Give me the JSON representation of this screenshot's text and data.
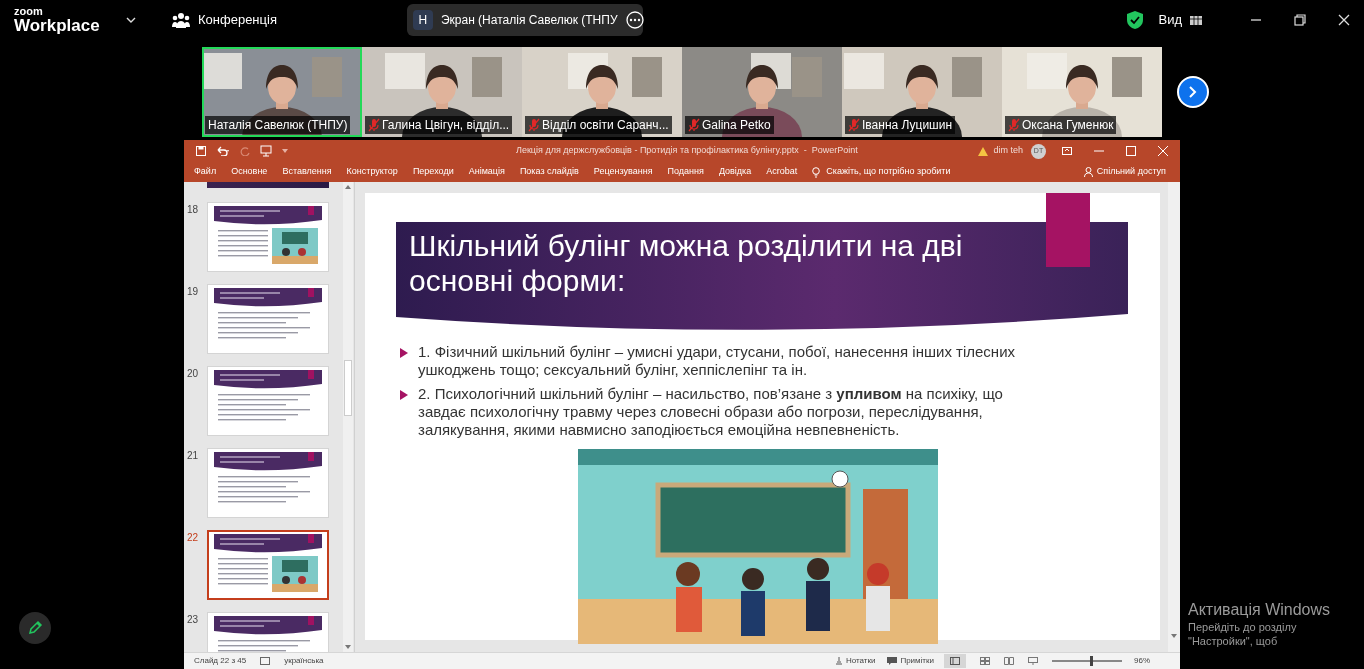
{
  "zoom": {
    "logo_top": "zoom",
    "logo_bottom": "Workplace",
    "meeting_label": "Конференція",
    "share_initial": "Н",
    "share_title": "Экран (Наталія Савелюк (ТНПУ",
    "view_label": "Вид"
  },
  "participants": [
    {
      "name": "Наталія Савелюк (ТНПУ)",
      "muted": false,
      "speaking": true
    },
    {
      "name": "Галина Цвігун, відділ...",
      "muted": true,
      "speaking": false
    },
    {
      "name": "Відділ освіти Саранч...",
      "muted": true,
      "speaking": false
    },
    {
      "name": "Galina Petko",
      "muted": true,
      "speaking": false
    },
    {
      "name": "Іванна Луцишин",
      "muted": true,
      "speaking": false
    },
    {
      "name": "Оксана Гуменюк",
      "muted": true,
      "speaking": false
    }
  ],
  "powerpoint": {
    "title": "Лекція для держслужбовців - Протидія та профілактика булінгу.pptx  -  PowerPoint",
    "user": "dim teh",
    "user_initials": "DT",
    "tabs": [
      "Файл",
      "Основне",
      "Вставлення",
      "Конструктор",
      "Переходи",
      "Анімація",
      "Показ слайдів",
      "Рецензування",
      "Подання",
      "Довідка",
      "Acrobat"
    ],
    "tell_me": "Скажіть, що потрібно зробити",
    "share": "Спільний доступ"
  },
  "thumbnails": [
    {
      "number": "18",
      "selected": false
    },
    {
      "number": "19",
      "kind": "text",
      "selected": false
    },
    {
      "number": "20",
      "kind": "text",
      "selected": false
    },
    {
      "number": "21",
      "kind": "text",
      "selected": false
    },
    {
      "number": "22",
      "selected": true
    },
    {
      "number": "23",
      "kind": "text",
      "selected": false
    }
  ],
  "slide": {
    "title": "Шкільний булінг можна розділити на дві основні форми:",
    "bullets": [
      "1. Фізичний шкільний булінг – умисні удари, стусани, побої, нанесення інших тілесних ушкоджень тощо; сексуальний булінг, хеппіслепінг та ін.",
      "2. Психологічний шкільний булінг – насильство, пов’язане з **упливом** на психіку, що завдає психологічну травму через словесні образи або погрози, переслідування, залякування, якими навмисно заподіюється емоційна невпевненість."
    ]
  },
  "status_bar": {
    "slide_info": "Слайд 22 з 45",
    "language": "українська",
    "notes": "Нотатки",
    "comments": "Примітки",
    "zoom_slider": {
      "level": 0.55
    },
    "zoom": "96%"
  },
  "activation": {
    "title": "Активація Windows",
    "hint": "Перейдіть до розділу \"Настройки\", щоб"
  }
}
